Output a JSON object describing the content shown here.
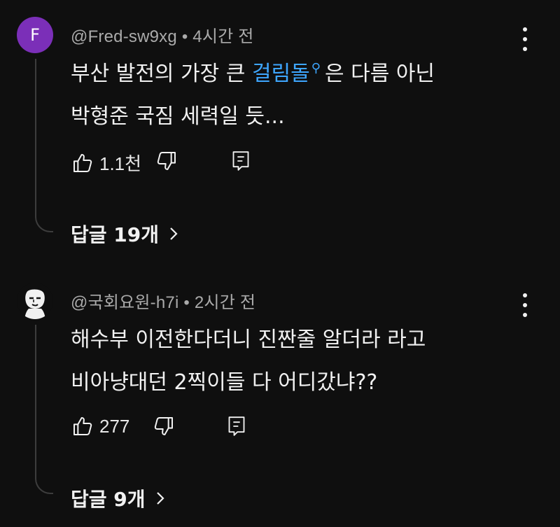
{
  "comments": [
    {
      "avatar_letter": "F",
      "avatar_color": "#7b2fb8",
      "author": "@Fred-sw9xg",
      "separator": "•",
      "time": "4시간 전",
      "line1_pre": "부산 발전의 가장 큰 ",
      "line1_link": "걸림돌",
      "line1_post": "은 다름 아닌",
      "line2": "박형준 국짐 세력일 듯...",
      "likes": "1.1천",
      "replies_label": "답글 19개"
    },
    {
      "avatar_icon": "face-icon",
      "author": "@국회요원-h7i",
      "separator": "•",
      "time": "2시간 전",
      "line1": "해수부 이전한다더니 진짠줄 알더라 라고",
      "line2": "비아냥대던 2찍이들 다 어디갔냐??",
      "likes": "277",
      "replies_label": "답글 9개"
    }
  ],
  "icons": {
    "like": "thumbs-up-icon",
    "dislike": "thumbs-down-icon",
    "reply": "comment-icon",
    "more": "more-vert-icon",
    "expand": "chevron-right-icon",
    "link_search": "search-icon"
  },
  "colors": {
    "background": "#0f0f0f",
    "link": "#3ea6ff",
    "meta": "#aaaaaa"
  }
}
